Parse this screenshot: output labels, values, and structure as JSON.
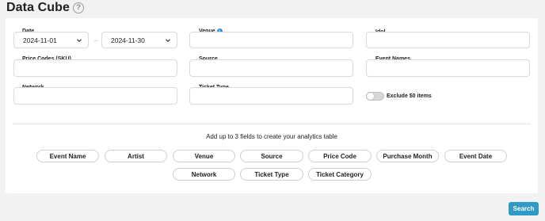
{
  "page": {
    "title": "Data Cube",
    "help_icon": "?"
  },
  "filters": {
    "date": {
      "label": "Date",
      "start": "2024-11-01",
      "end": "2024-11-30",
      "separator": "–"
    },
    "venue": {
      "label": "Venue",
      "info_icon": "i",
      "value": ""
    },
    "idol": {
      "label": "Idol",
      "value": ""
    },
    "price_codes": {
      "label": "Price Codes (SKU)",
      "value": ""
    },
    "source": {
      "label": "Source",
      "value": ""
    },
    "event_names": {
      "label": "Event Names",
      "value": ""
    },
    "network": {
      "label": "Network",
      "value": ""
    },
    "ticket_type": {
      "label": "Ticket Type",
      "value": ""
    },
    "exclude_zero": {
      "label": "Exclude $0 items",
      "checked": false
    }
  },
  "analytics": {
    "hint": "Add up to 3 fields to create your analytics table",
    "chips": [
      "Event Name",
      "Artist",
      "Venue",
      "Source",
      "Price Code",
      "Purchase Month",
      "Event Date",
      "Network",
      "Ticket Type",
      "Ticket Category"
    ]
  },
  "actions": {
    "search_label": "Search"
  },
  "colors": {
    "accent": "#2f9ac6",
    "info": "#2f8fd0"
  }
}
